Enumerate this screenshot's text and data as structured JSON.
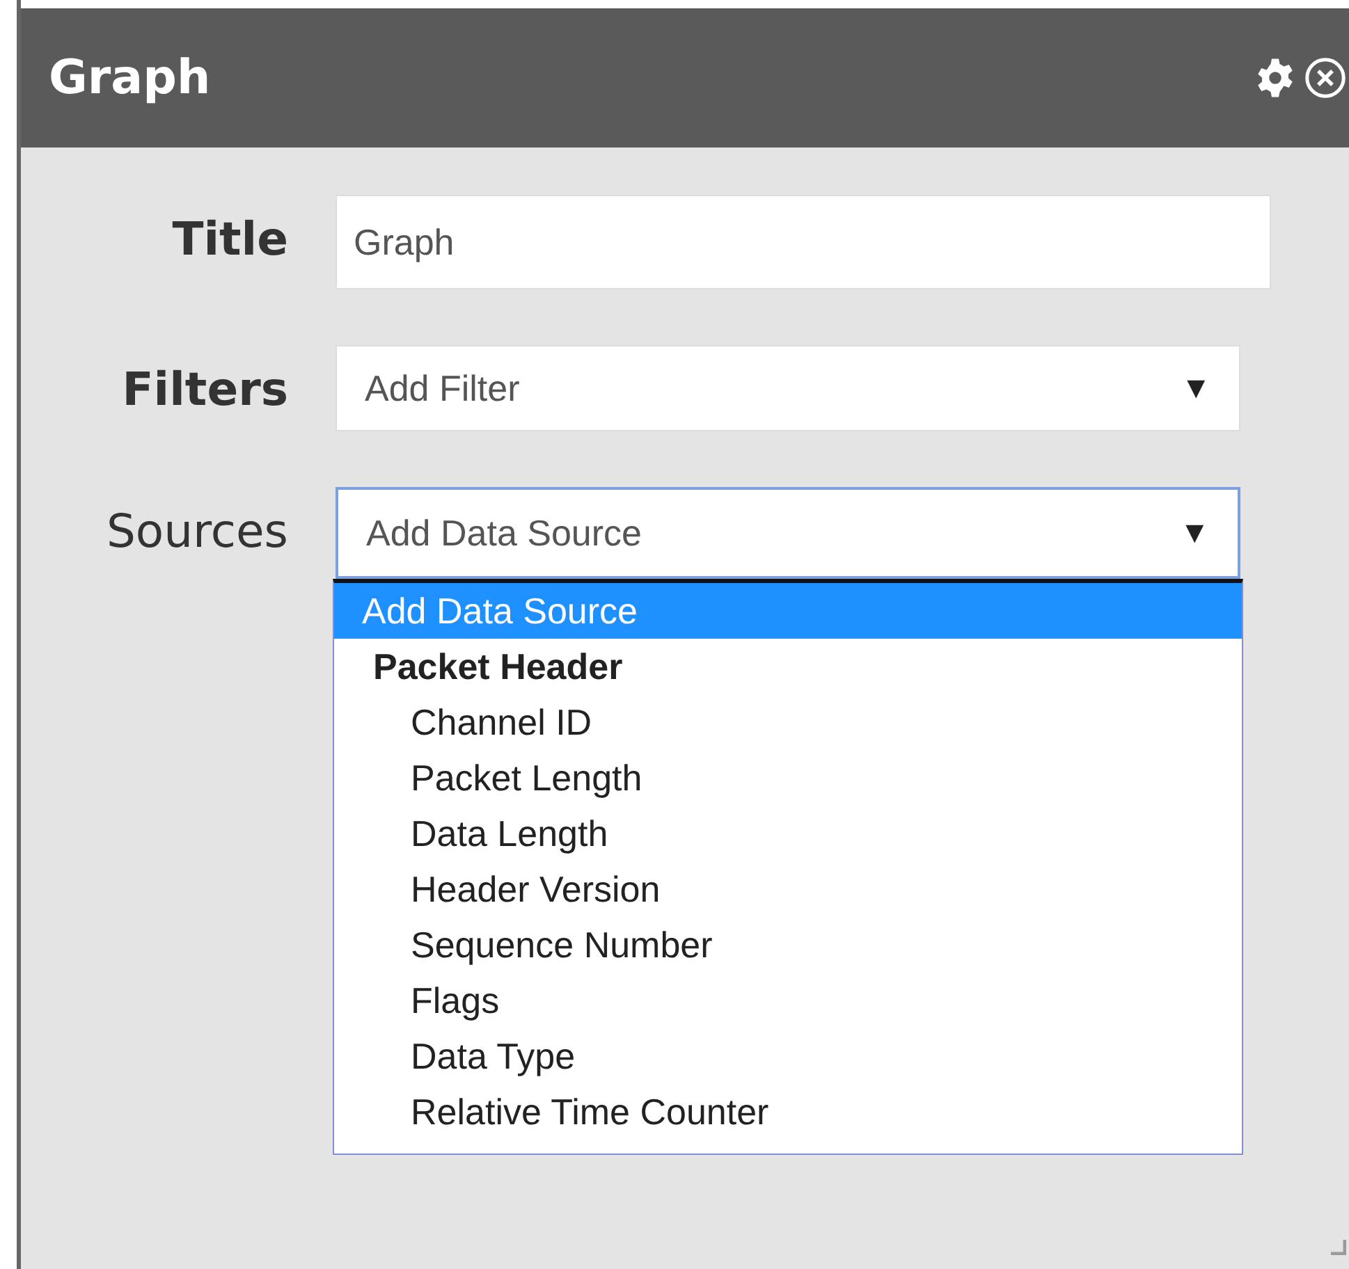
{
  "window": {
    "title": "Graph"
  },
  "fields": [
    {
      "label": "Title",
      "bold": true,
      "kind": "text",
      "value": "Graph",
      "focused": false
    },
    {
      "label": "Filters",
      "bold": true,
      "kind": "select",
      "value": "Add Filter",
      "focused": false,
      "arrow": "▼"
    },
    {
      "label": "Sources",
      "bold": false,
      "kind": "select",
      "value": "Add Data Source",
      "focused": true,
      "arrow": "▼"
    }
  ],
  "dropdown": {
    "options": [
      {
        "label": "Add Data Source",
        "selected": true
      },
      {
        "label": "Packet Header",
        "selected": false,
        "children": [
          {
            "label": "Channel ID",
            "selected": false
          },
          {
            "label": "Packet Length",
            "selected": false
          },
          {
            "label": "Data Length",
            "selected": false
          },
          {
            "label": "Header Version",
            "selected": false
          },
          {
            "label": "Sequence Number",
            "selected": false
          },
          {
            "label": "Flags",
            "selected": false
          },
          {
            "label": "Data Type",
            "selected": false
          },
          {
            "label": "Relative Time Counter",
            "selected": false
          }
        ]
      }
    ]
  }
}
